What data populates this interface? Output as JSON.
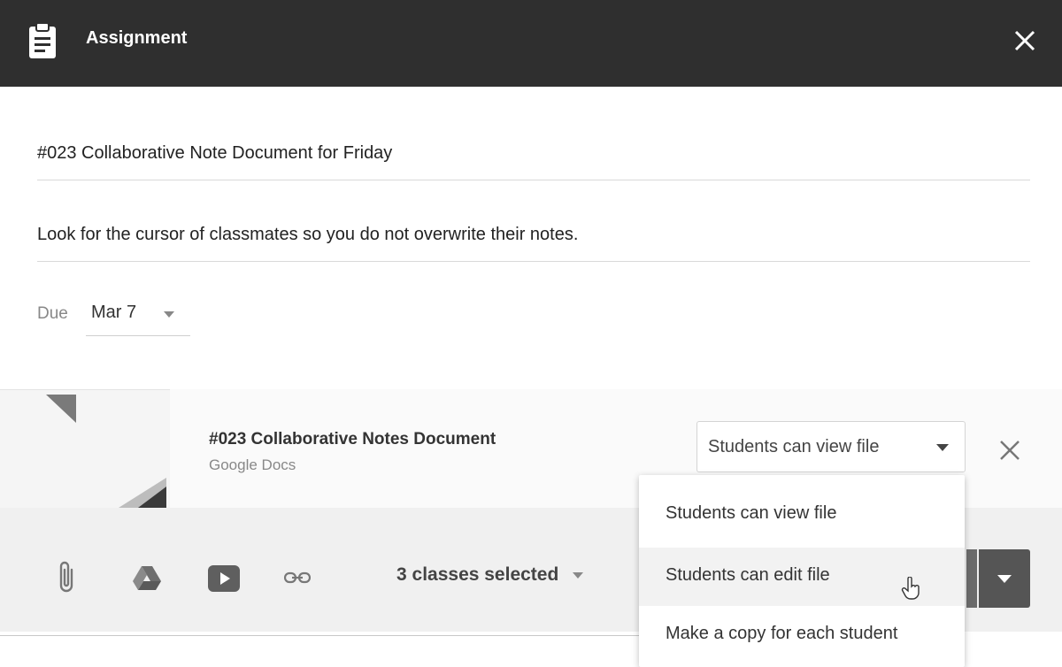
{
  "header": {
    "title": "Assignment",
    "icon": "clipboard-icon",
    "close_icon": "close-icon",
    "background": "#2f2f2f"
  },
  "form": {
    "title_value": "#023 Collaborative Note Document for Friday",
    "description_value": "Look for the cursor of classmates so you do not overwrite their notes.",
    "due_label": "Due",
    "due_value": "Mar 7"
  },
  "attachment": {
    "name": "#023 Collaborative Notes Document",
    "type": "Google Docs",
    "permission_selected": "Students can view file",
    "remove_icon": "close-icon"
  },
  "permission_menu": {
    "items": [
      {
        "label": "Students can view file"
      },
      {
        "label": "Students can edit file"
      },
      {
        "label": "Make a copy for each student"
      }
    ],
    "hovered_index": 1
  },
  "toolbar": {
    "tools": [
      "paperclip-icon",
      "drive-icon",
      "youtube-icon",
      "link-icon"
    ],
    "classes_label": "3 classes selected"
  },
  "colors": {
    "header_bg": "#2f2f2f",
    "assign_button": "#555555"
  }
}
